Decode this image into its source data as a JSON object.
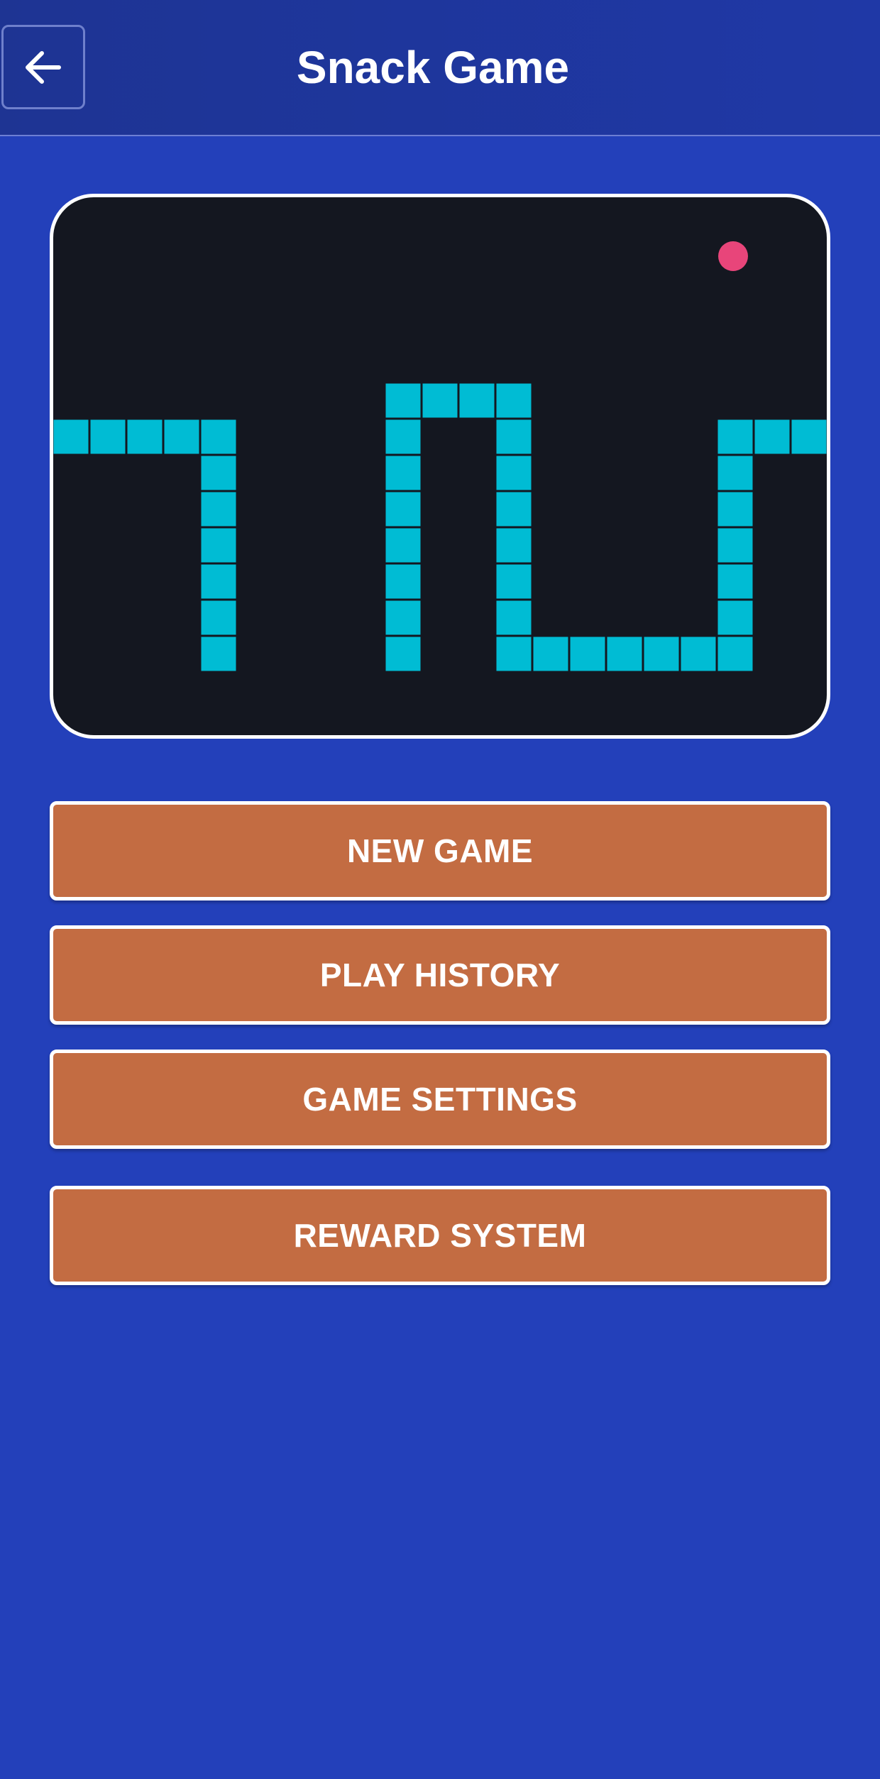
{
  "app_bar": {
    "title": "Snack Game",
    "back_icon": "arrow-left-icon"
  },
  "colors": {
    "background": "#2340ba",
    "app_bar": "#1f38a6",
    "board_background": "#141720",
    "snake": "#00bcd4",
    "food": "#e8457a",
    "button": "#c36c42",
    "button_text": "#ffffff"
  },
  "menu": {
    "new_game": "NEW GAME",
    "play_history": "PLAY HISTORY",
    "game_settings": "GAME SETTINGS",
    "reward_system": "REWARD SYSTEM"
  }
}
